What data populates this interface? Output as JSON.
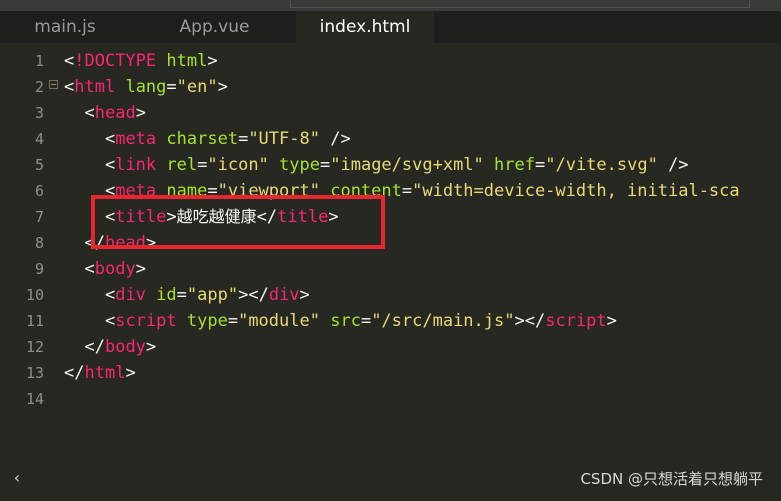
{
  "tabs": [
    {
      "label": "main.js"
    },
    {
      "label": "App.vue"
    },
    {
      "label": "index.html"
    }
  ],
  "line_numbers": [
    "1",
    "2",
    "3",
    "4",
    "5",
    "6",
    "7",
    "8",
    "9",
    "10",
    "11",
    "12",
    "13",
    "14"
  ],
  "code": {
    "l1": {
      "lt": "<",
      "bang": "!DOCTYPE",
      "sp": " ",
      "html": "html",
      "gt": ">"
    },
    "l2": {
      "lt": "<",
      "tag": "html",
      "sp": " ",
      "attr": "lang",
      "eq": "=",
      "val": "\"en\"",
      "gt": ">"
    },
    "l3": {
      "indent": "  ",
      "lt": "<",
      "tag": "head",
      "gt": ">"
    },
    "l4": {
      "indent": "    ",
      "lt": "<",
      "tag": "meta",
      "sp": " ",
      "attr": "charset",
      "eq": "=",
      "val": "\"UTF-8\"",
      "close": " />"
    },
    "l5": {
      "indent": "    ",
      "lt": "<",
      "tag": "link",
      "sp1": " ",
      "attr1": "rel",
      "eq1": "=",
      "val1": "\"icon\"",
      "sp2": " ",
      "attr2": "type",
      "eq2": "=",
      "val2": "\"image/svg+xml\"",
      "sp3": " ",
      "attr3": "href",
      "eq3": "=",
      "val3": "\"/vite.svg\"",
      "close": " />"
    },
    "l6": {
      "indent": "    ",
      "lt": "<",
      "tag": "meta",
      "sp1": " ",
      "attr1": "name",
      "eq1": "=",
      "val1": "\"viewport\"",
      "sp2": " ",
      "attr2": "content",
      "eq2": "=",
      "val2": "\"width=device-width, initial-sca"
    },
    "l7": {
      "indent": "    ",
      "lt": "<",
      "tag": "title",
      "gt": ">",
      "text": "越吃越健康",
      "lt2": "</",
      "tag2": "title",
      "gt2": ">"
    },
    "l8": {
      "indent": "  ",
      "lt": "</",
      "tag": "head",
      "gt": ">"
    },
    "l9": {
      "indent": "  ",
      "lt": "<",
      "tag": "body",
      "gt": ">"
    },
    "l10": {
      "indent": "    ",
      "lt": "<",
      "tag": "div",
      "sp": " ",
      "attr": "id",
      "eq": "=",
      "val": "\"app\"",
      "gt": ">",
      "lt2": "</",
      "tag2": "div",
      "gt2": ">"
    },
    "l11": {
      "indent": "    ",
      "lt": "<",
      "tag": "script",
      "sp1": " ",
      "attr1": "type",
      "eq1": "=",
      "val1": "\"module\"",
      "sp2": " ",
      "attr2": "src",
      "eq2": "=",
      "val2": "\"/src/main.js\"",
      "gt": ">",
      "lt2": "</",
      "tag2": "script",
      "gt2": ">"
    },
    "l12": {
      "indent": "  ",
      "lt": "</",
      "tag": "body",
      "gt": ">"
    },
    "l13": {
      "lt": "</",
      "tag": "html",
      "gt": ">"
    }
  },
  "scroll_left_glyph": "‹",
  "watermark": "CSDN @只想活着只想躺平",
  "colors": {
    "background": "#272822",
    "tag": "#f92672",
    "attribute": "#a6e22e",
    "string": "#e6db74",
    "highlight_box": "#e8262f"
  }
}
